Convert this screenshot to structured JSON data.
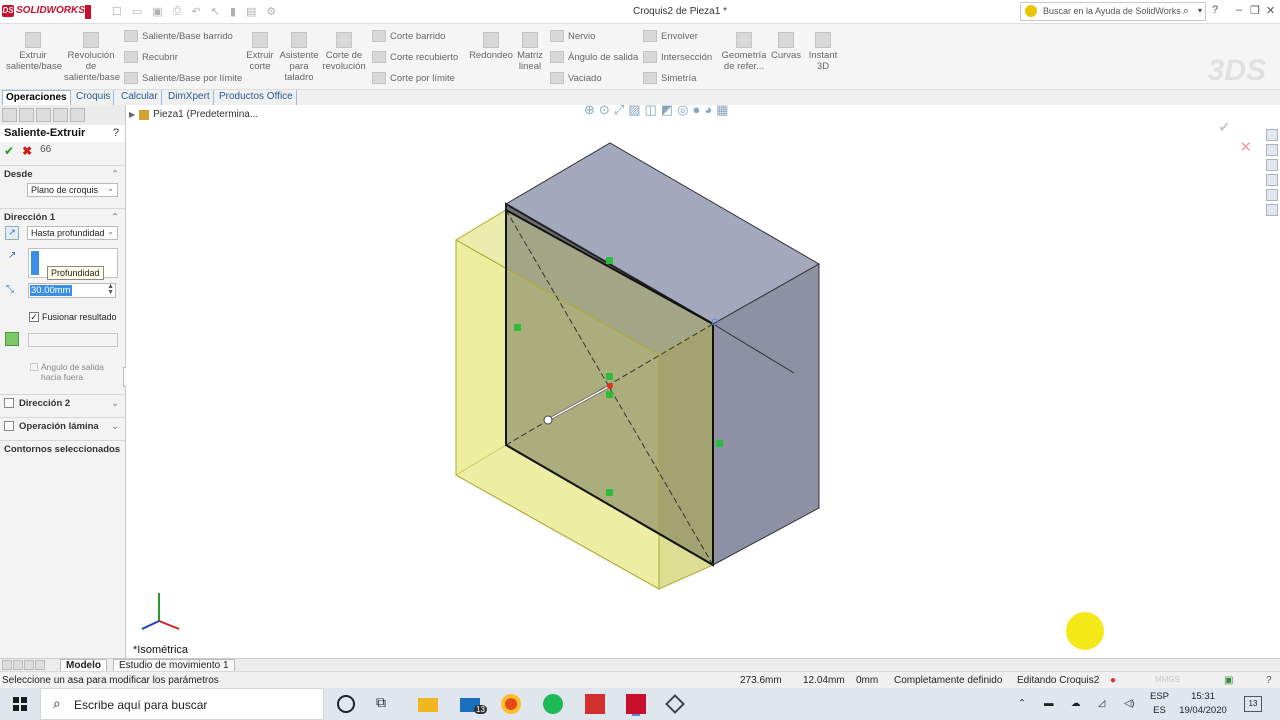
{
  "titlebar": {
    "app_name": "SOLIDWORKS",
    "doc_title": "Croquis2 de Pieza1 *",
    "search_placeholder": "Buscar en la Ayuda de SolidWorks"
  },
  "ribbon": {
    "extrude": [
      "Extruir",
      "saliente/base"
    ],
    "revolve": [
      "Revolución",
      "de",
      "saliente/base"
    ],
    "swept_boss": "Saliente/Base barrido",
    "loft": "Recubrir",
    "boundary_boss": "Saliente/Base por límite",
    "extrude_cut": [
      "Extruir",
      "corte"
    ],
    "hole_wizard": [
      "Asistente",
      "para",
      "taladro"
    ],
    "revolve_cut": [
      "Corte de",
      "revolución"
    ],
    "swept_cut": "Corte barrido",
    "lofted_cut": "Corte recubierto",
    "boundary_cut": "Corte por límite",
    "fillet": "Redondeo",
    "linear_pattern": [
      "Matriz",
      "lineal"
    ],
    "rib": "Nervio",
    "draft": "Ángulo de salida",
    "shell": "Vaciado",
    "wrap": "Envolver",
    "intersect": "Intersección",
    "mirror": "Simetría",
    "ref_geometry": [
      "Geometría",
      "de refer..."
    ],
    "curves": "Curvas",
    "instant3d": [
      "Instant",
      "3D"
    ]
  },
  "tabs": [
    "Operaciones",
    "Croquis",
    "Calcular",
    "DimXpert",
    "Productos Office"
  ],
  "property_manager": {
    "title": "Saliente-Extruir",
    "help": "?",
    "from_label": "Desde",
    "from_value": "Plano de croquis",
    "dir1_label": "Dirección 1",
    "end_condition": "Hasta profundidad",
    "tooltip": "Profundidad",
    "depth": "30.00mm",
    "merge_label": "Fusionar resultado",
    "draft_label": [
      "Ángulo de salida",
      "hacia fuera"
    ],
    "dir2_label": "Dirección 2",
    "thin_label": "Operación lámina",
    "contours_label": "Contornos seleccionados"
  },
  "graphics": {
    "tree_root": "Pieza1  (Predetermina...",
    "view_label": "*Isométrica"
  },
  "bottom_tabs": [
    "Modelo",
    "Estudio de movimiento 1"
  ],
  "status": {
    "message": "Seleccione un asa para modificar los parámetros",
    "x": "273.6mm",
    "y": "12.04mm",
    "z": "0mm",
    "state": "Completamente definido",
    "editing": "Editando Croquis2",
    "units": "MMGS"
  },
  "taskbar": {
    "search_text": "Escribe aquí para buscar",
    "lang_top": "ESP",
    "lang_bottom": "ES",
    "time": "15:31",
    "date": "19/04/2020",
    "notif_count": "13",
    "mail_badge": "13"
  },
  "colors": {
    "accent_red": "#c8102e",
    "sketch_yellow": "#eeee88",
    "selection_blue": "#3a8ee6"
  }
}
